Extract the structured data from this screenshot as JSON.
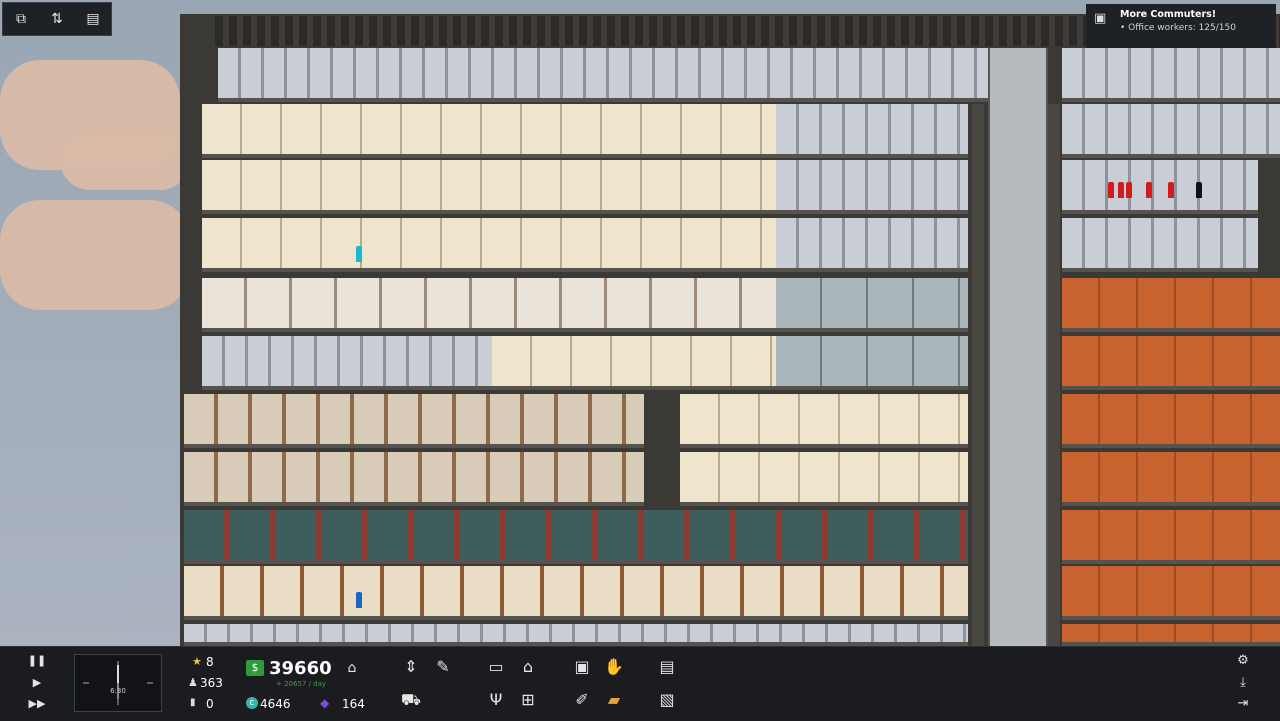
{
  "toolbar_top": {
    "icons": [
      "layers-icon",
      "sort-icon",
      "list-icon"
    ]
  },
  "notification": {
    "title": "More Commuters!",
    "detail": "• Office workers: 125/150",
    "icon": "briefcase-icon"
  },
  "time_controls": {
    "icons": [
      "pause-icon",
      "play-icon",
      "fast-forward-icon"
    ],
    "clock": "6:30"
  },
  "stats": {
    "stars": "8",
    "population": "363",
    "zero_count": "0",
    "money": "39660",
    "money_rate": "+ 20657 / day",
    "tokens": "4646",
    "influence": "164"
  },
  "build_tools": {
    "icons": [
      "bank-icon",
      "elevator-icon",
      "tools-icon",
      "office-desk-icon",
      "house-icon",
      "box-icon",
      "handshake-icon",
      "document-icon",
      "bulldozer-icon",
      "fork-knife-icon",
      "cart-icon",
      "paint-brush-icon",
      "folder-icon",
      "picture-icon"
    ]
  },
  "right_tools": {
    "icons": [
      "gear-icon",
      "download-icon",
      "exit-icon"
    ]
  },
  "colors": {
    "money_green": "#2f9b3a",
    "bar_bg": "#1a1c20",
    "star": "#e8c04a",
    "influence": "#7d4bd6"
  }
}
